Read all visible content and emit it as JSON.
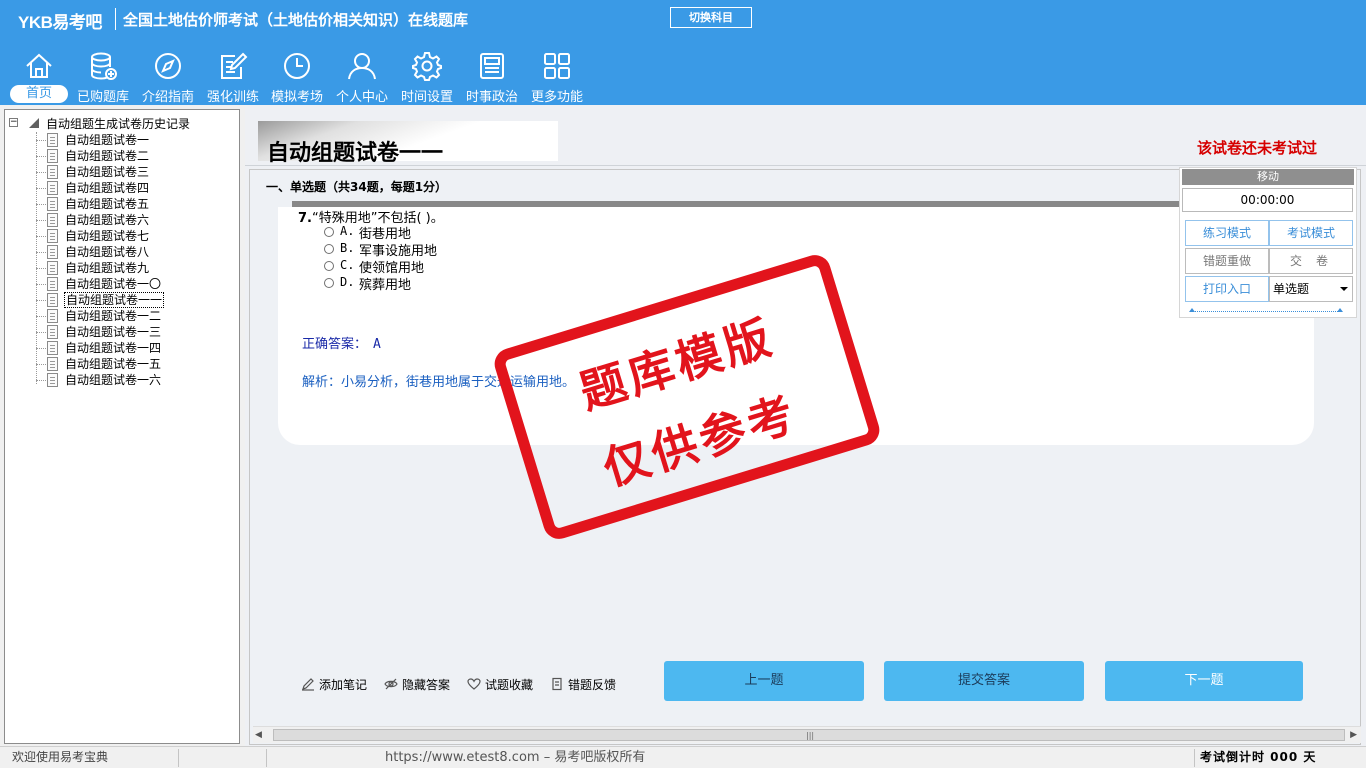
{
  "header": {
    "brand": "YKB易考吧",
    "title": "全国土地估价师考试（土地估价相关知识）在线题库",
    "switch_label": "切换科目"
  },
  "nav": [
    {
      "label": "首页",
      "icon": "home-icon"
    },
    {
      "label": "已购题库",
      "icon": "database-icon"
    },
    {
      "label": "介绍指南",
      "icon": "compass-icon"
    },
    {
      "label": "强化训练",
      "icon": "edit-icon"
    },
    {
      "label": "模拟考场",
      "icon": "clock-icon"
    },
    {
      "label": "个人中心",
      "icon": "user-icon"
    },
    {
      "label": "时间设置",
      "icon": "gear-icon"
    },
    {
      "label": "时事政治",
      "icon": "news-icon"
    },
    {
      "label": "更多功能",
      "icon": "grid-icon"
    }
  ],
  "tree": {
    "root_label": "自动组题生成试卷历史记录",
    "items": [
      "自动组题试卷一",
      "自动组题试卷二",
      "自动组题试卷三",
      "自动组题试卷四",
      "自动组题试卷五",
      "自动组题试卷六",
      "自动组题试卷七",
      "自动组题试卷八",
      "自动组题试卷九",
      "自动组题试卷一〇",
      "自动组题试卷一一",
      "自动组题试卷一二",
      "自动组题试卷一三",
      "自动组题试卷一四",
      "自动组题试卷一五",
      "自动组题试卷一六"
    ],
    "selected_index": 10
  },
  "paper": {
    "title": "自动组题试卷一一",
    "status": "该试卷还未考试过",
    "section_header": "一、单选题（共34题，每题1分）"
  },
  "question": {
    "number": "7.",
    "stem": "“特殊用地”不包括( )。",
    "options": [
      {
        "letter": "A.",
        "text": "街巷用地"
      },
      {
        "letter": "B.",
        "text": "军事设施用地"
      },
      {
        "letter": "C.",
        "text": "使领馆用地"
      },
      {
        "letter": "D.",
        "text": "殡葬用地"
      }
    ],
    "answer_label": "正确答案：",
    "answer_value": "A",
    "analysis": "解析：小易分析，街巷用地属于交通运输用地。"
  },
  "stamp": {
    "line1": "题库模版",
    "line2": "仅供参考",
    "color": "#e2141c"
  },
  "tools": [
    {
      "label": "添加笔记",
      "icon": "pencil-icon"
    },
    {
      "label": "隐藏答案",
      "icon": "eye-icon"
    },
    {
      "label": "试题收藏",
      "icon": "heart-icon"
    },
    {
      "label": "错题反馈",
      "icon": "feedback-icon"
    }
  ],
  "buttons": {
    "prev": "上一题",
    "submit": "提交答案",
    "next": "下一题"
  },
  "side_panel": {
    "move_label": "移动",
    "timer": "00:00:00",
    "practice_mode": "练习模式",
    "exam_mode": "考试模式",
    "redo_wrong": "错题重做",
    "submit_paper": "交卷",
    "print_entry": "打印入口",
    "question_type": "单选题"
  },
  "status_bar": {
    "welcome": "欢迎使用易考宝典",
    "copyright": "https://www.etest8.com – 易考吧版权所有",
    "countdown": "考试倒计时 000 天"
  },
  "colors": {
    "header_bg": "#3a9ae6",
    "button_bg": "#4db8f0",
    "status_red": "#d60000"
  }
}
